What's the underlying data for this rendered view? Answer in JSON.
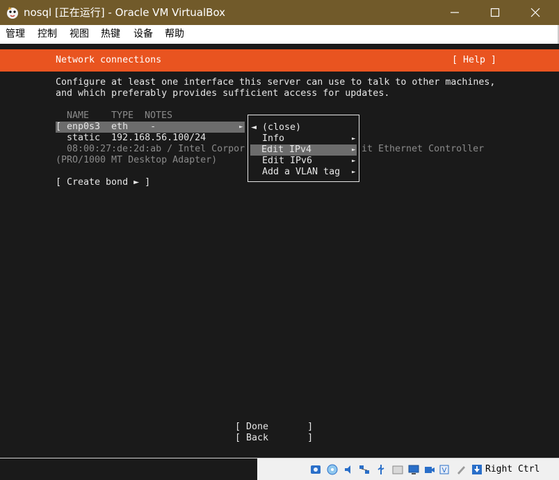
{
  "window": {
    "title": "nosql [正在运行] - Oracle VM VirtualBox"
  },
  "menubar": {
    "items": [
      "管理",
      "控制",
      "视图",
      "热键",
      "设备",
      "帮助"
    ]
  },
  "installer": {
    "header_title": "Network connections",
    "help_label": "[ Help ]",
    "intro_line1": "Configure at least one interface this server can use to talk to other machines,",
    "intro_line2": "and which preferably provides sufficient access for updates.",
    "columns": {
      "name": "NAME",
      "type": "TYPE",
      "notes": "NOTES"
    },
    "interface": {
      "row": "[ enp0s3  eth    -",
      "row_arrow": "►",
      "static_line": "static  192.168.56.100/24",
      "hw_line_left": "08:00:27:de:2d:ab / Intel Corpor",
      "hw_line_right": "it Ethernet Controller",
      "hw_line2": "(PRO/1000 MT Desktop Adapter)"
    },
    "create_bond": "[ Create bond ► ]",
    "popup": {
      "close": "◄ (close)",
      "items": [
        "Info",
        "Edit IPv4",
        "Edit IPv6",
        "Add a VLAN tag"
      ],
      "arrow": "►"
    },
    "done_label": "[ Done       ]",
    "back_label": "[ Back       ]"
  },
  "statusbar": {
    "host_key": "Right Ctrl"
  }
}
